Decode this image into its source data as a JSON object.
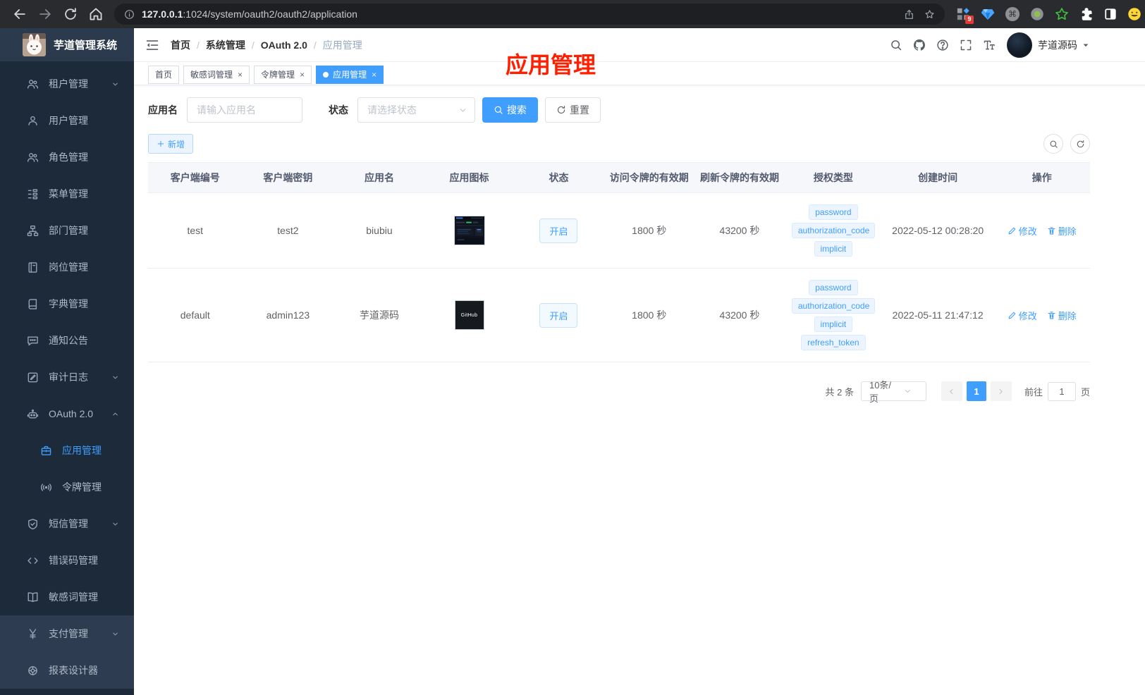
{
  "browser": {
    "url": {
      "host": "127.0.0.1",
      "rest": ":1024/system/oauth2/oauth2/application"
    },
    "extension_badge": "9"
  },
  "sidebar": {
    "logo_title": "芋道管理系统",
    "items": [
      {
        "key": "tenant",
        "label": "租户管理",
        "icon": "users-icon",
        "chevron": "down"
      },
      {
        "key": "user",
        "label": "用户管理",
        "icon": "user-icon"
      },
      {
        "key": "role",
        "label": "角色管理",
        "icon": "role-icon"
      },
      {
        "key": "menu",
        "label": "菜单管理",
        "icon": "menu-tree-icon"
      },
      {
        "key": "dept",
        "label": "部门管理",
        "icon": "org-icon"
      },
      {
        "key": "post",
        "label": "岗位管理",
        "icon": "post-icon"
      },
      {
        "key": "dict",
        "label": "字典管理",
        "icon": "dict-icon"
      },
      {
        "key": "notice",
        "label": "通知公告",
        "icon": "notice-icon"
      },
      {
        "key": "audit-log",
        "label": "审计日志",
        "icon": "audit-icon",
        "chevron": "down"
      },
      {
        "key": "oauth2",
        "label": "OAuth 2.0",
        "icon": "robot-icon",
        "chevron": "up"
      },
      {
        "key": "oauth2-app",
        "label": "应用管理",
        "icon": "briefcase-icon",
        "sub": true,
        "active": true
      },
      {
        "key": "oauth2-token",
        "label": "令牌管理",
        "icon": "broadcast-icon",
        "sub": true
      },
      {
        "key": "sms",
        "label": "短信管理",
        "icon": "shield-check-icon",
        "chevron": "down"
      },
      {
        "key": "error-code",
        "label": "错误码管理",
        "icon": "code-icon"
      },
      {
        "key": "sensitive-word",
        "label": "敏感词管理",
        "icon": "book-open-icon"
      },
      {
        "key": "pay",
        "label": "支付管理",
        "icon": "yen-icon",
        "chevron": "down",
        "section": "light"
      },
      {
        "key": "report",
        "label": "报表设计器",
        "icon": "report-icon",
        "section": "light"
      }
    ]
  },
  "header": {
    "breadcrumbs": [
      "首页",
      "系统管理",
      "OAuth 2.0",
      "应用管理"
    ],
    "user_name": "芋道源码"
  },
  "annotation": {
    "text": "应用管理",
    "color": "#ff1f00"
  },
  "tabs": [
    {
      "label": "首页",
      "closable": false,
      "active": false
    },
    {
      "label": "敏感词管理",
      "closable": true,
      "active": false
    },
    {
      "label": "令牌管理",
      "closable": true,
      "active": false
    },
    {
      "label": "应用管理",
      "closable": true,
      "active": true
    }
  ],
  "filters": {
    "name_label": "应用名",
    "name_placeholder": "请输入应用名",
    "status_label": "状态",
    "status_placeholder": "请选择状态",
    "search_label": "搜索",
    "reset_label": "重置"
  },
  "toolbar": {
    "add_label": "新增"
  },
  "table": {
    "columns": [
      "客户端编号",
      "客户端密钥",
      "应用名",
      "应用图标",
      "状态",
      "访问令牌的有效期",
      "刷新令牌的有效期",
      "授权类型",
      "创建时间",
      "操作"
    ],
    "rows": [
      {
        "client_id": "test",
        "secret": "test2",
        "name": "biubiu",
        "icon": "dashboard-thumb",
        "icon_text": "",
        "status": "开启",
        "access_validity": "1800 秒",
        "refresh_validity": "43200 秒",
        "grant_types": [
          "password",
          "authorization_code",
          "implicit"
        ],
        "created_at": "2022-05-12 00:28:20"
      },
      {
        "client_id": "default",
        "secret": "admin123",
        "name": "芋道源码",
        "icon": "github-thumb",
        "icon_text": "GitHub",
        "status": "开启",
        "access_validity": "1800 秒",
        "refresh_validity": "43200 秒",
        "grant_types": [
          "password",
          "authorization_code",
          "implicit",
          "refresh_token"
        ],
        "created_at": "2022-05-11 21:47:12"
      }
    ],
    "actions": {
      "edit": "修改",
      "delete": "删除"
    }
  },
  "pagination": {
    "total_text": "共 2 条",
    "page_size": "10条/页",
    "current_page": "1",
    "goto_label": "前往",
    "goto_value": "1",
    "page_unit": "页"
  },
  "colors": {
    "accent": "#409eff",
    "annotation": "#ff1f00",
    "sidebar_bg": "#1d2a3a",
    "tag_bg": "#ecf5ff"
  }
}
